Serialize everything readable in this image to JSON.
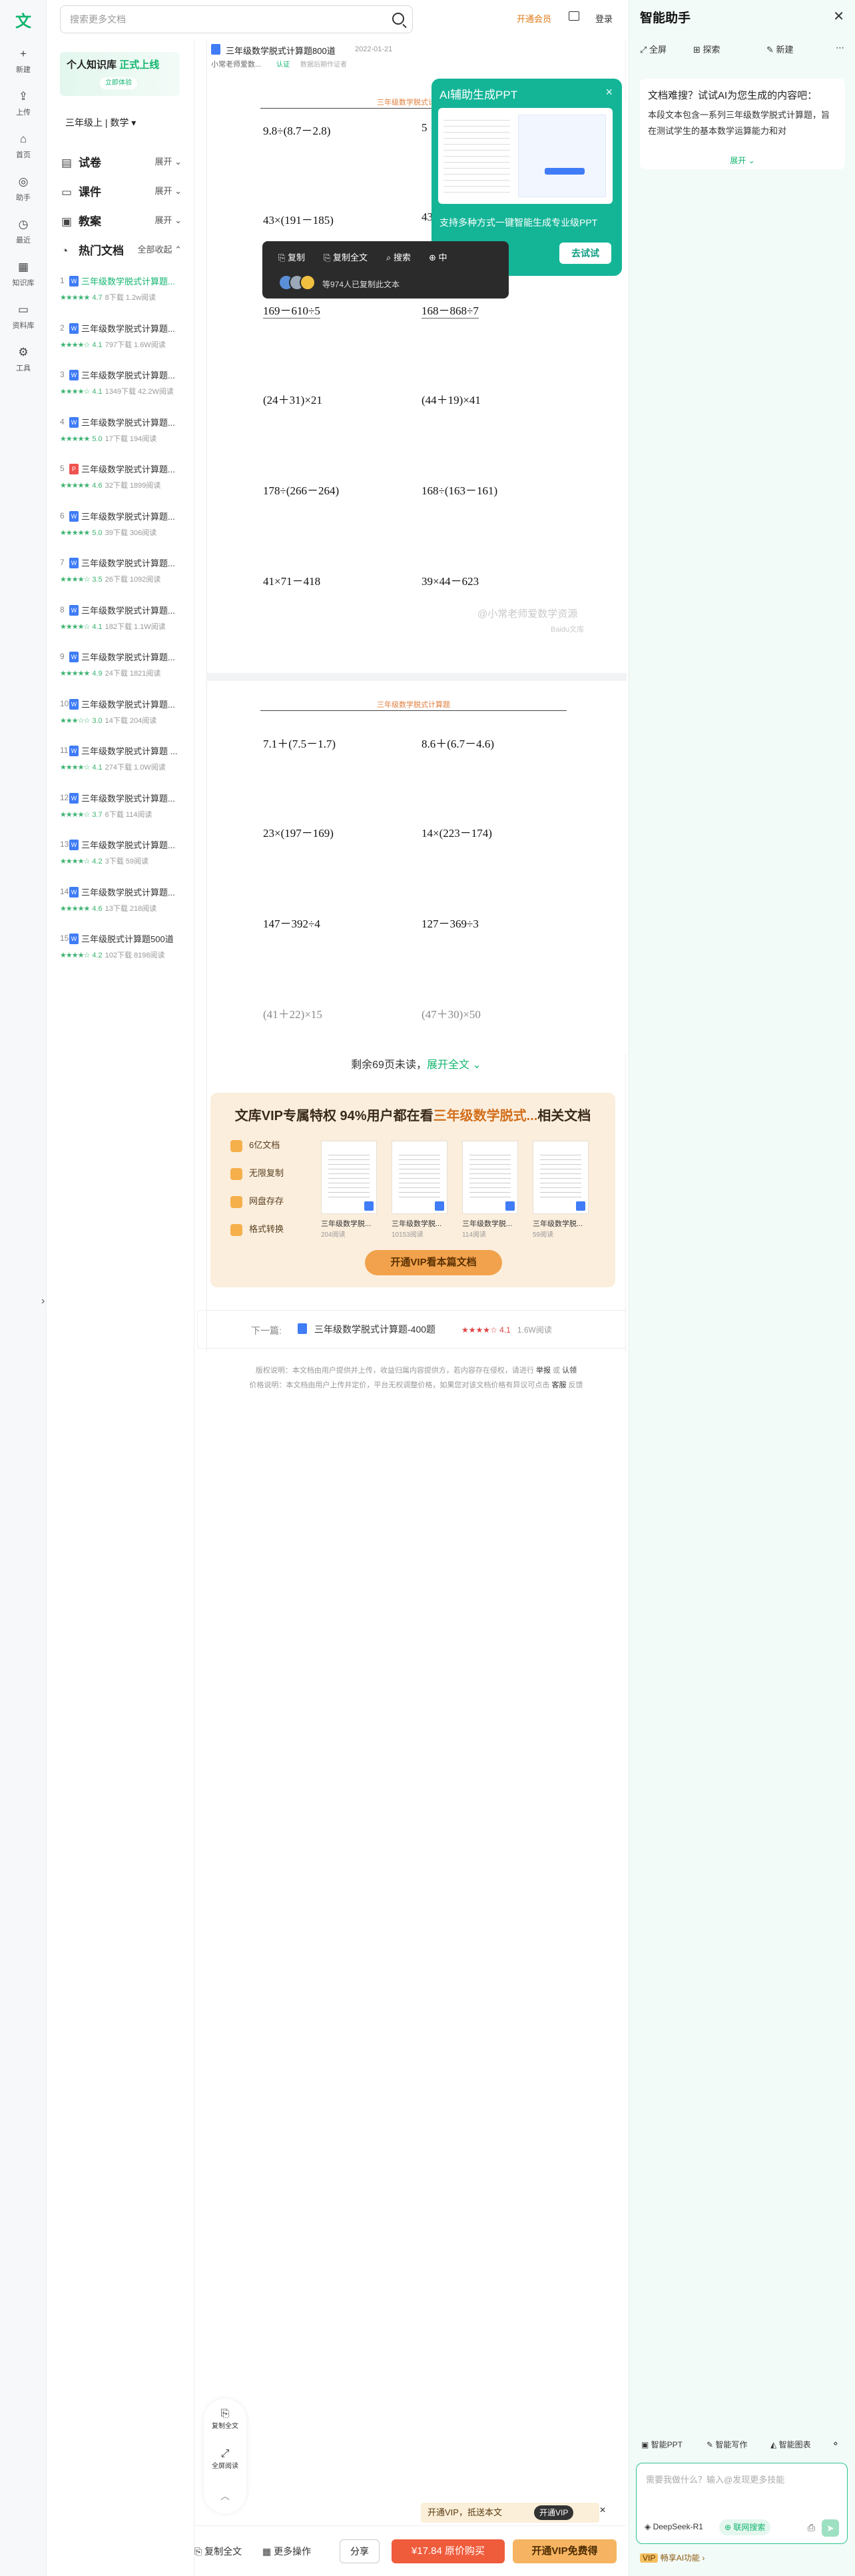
{
  "search": {
    "placeholder": "搜索更多文档"
  },
  "header": {
    "open_vip": "开通会员",
    "login": "登录"
  },
  "rail": {
    "logo": "文",
    "items": [
      {
        "label": "新建",
        "icon": "+"
      },
      {
        "label": "上传",
        "icon": "⇪"
      },
      {
        "label": "首页",
        "icon": "⌂"
      },
      {
        "label": "助手",
        "icon": "◎"
      },
      {
        "label": "最近",
        "icon": "◷"
      },
      {
        "label": "知识库",
        "icon": "▦"
      },
      {
        "label": "资料库",
        "icon": "▭"
      },
      {
        "label": "工具",
        "icon": "⚙"
      }
    ]
  },
  "sidebar": {
    "banner_title": "个人知识库",
    "banner_highlight": "正式上线",
    "banner_button": "立即体验",
    "grade": "三年级上",
    "subject": "数学",
    "sections": [
      {
        "label": "试卷",
        "action": "展开"
      },
      {
        "label": "课件",
        "action": "展开"
      },
      {
        "label": "教案",
        "action": "展开"
      }
    ],
    "hot": {
      "label": "热门文档",
      "action": "全部收起"
    },
    "hot_items": [
      {
        "num": "1",
        "title": "三年级数学脱式计算题...",
        "rating": "4.7",
        "meta": "8下载  1.2w阅读",
        "type": "W"
      },
      {
        "num": "2",
        "title": "三年级数学脱式计算题...",
        "rating": "4.1",
        "meta": "797下载  1.6W阅读",
        "type": "W"
      },
      {
        "num": "3",
        "title": "三年级数学脱式计算题...",
        "rating": "4.1",
        "meta": "1349下载  42.2W阅读",
        "type": "W"
      },
      {
        "num": "4",
        "title": "三年级数学脱式计算题...",
        "rating": "5.0",
        "meta": "17下载  194阅读",
        "type": "W"
      },
      {
        "num": "5",
        "title": "三年级数学脱式计算题...",
        "rating": "4.6",
        "meta": "32下载  1899阅读",
        "type": "P"
      },
      {
        "num": "6",
        "title": "三年级数学脱式计算题...",
        "rating": "5.0",
        "meta": "39下载  306阅读",
        "type": "W"
      },
      {
        "num": "7",
        "title": "三年级数学脱式计算题...",
        "rating": "3.5",
        "meta": "26下载  1092阅读",
        "type": "W"
      },
      {
        "num": "8",
        "title": "三年级数学脱式计算题...",
        "rating": "4.1",
        "meta": "182下载  1.1W阅读",
        "type": "W"
      },
      {
        "num": "9",
        "title": "三年级数学脱式计算题...",
        "rating": "4.9",
        "meta": "24下载  1821阅读",
        "type": "W"
      },
      {
        "num": "10",
        "title": "三年级数学脱式计算题...",
        "rating": "3.0",
        "meta": "14下载  204阅读",
        "type": "W"
      },
      {
        "num": "11",
        "title": "三年级数学脱式计算题 ...",
        "rating": "4.1",
        "meta": "274下载  1.0W阅读",
        "type": "W"
      },
      {
        "num": "12",
        "title": "三年级数学脱式计算题...",
        "rating": "3.7",
        "meta": "6下载  114阅读",
        "type": "W"
      },
      {
        "num": "13",
        "title": "三年级数学脱式计算题...",
        "rating": "4.2",
        "meta": "3下载  59阅读",
        "type": "W"
      },
      {
        "num": "14",
        "title": "三年级数学脱式计算题...",
        "rating": "4.6",
        "meta": "13下载  218阅读",
        "type": "W"
      },
      {
        "num": "15",
        "title": "三年级脱式计算题500道",
        "rating": "4.2",
        "meta": "102下载  8198阅读",
        "type": "W"
      }
    ]
  },
  "doc": {
    "title": "三年级数学脱式计算题800道",
    "date": "2022-01-21",
    "author": "小常老师爱数...",
    "author_badge": "认证",
    "author_note": "数据后期作证者",
    "header_strip": "三年级数学脱式计算题",
    "page1": [
      "9.8÷(8.7－2.8)",
      "5",
      "43×(191－185)",
      "43",
      "169－610÷5",
      "168－868÷7",
      "(24＋31)×21",
      "(44＋19)×41",
      "178÷(266－264)",
      "168÷(163－161)",
      "41×71－418",
      "39×44－623"
    ],
    "watermark1": "@小常老师爱数学资源",
    "watermark2": "Baidu文库",
    "page2": [
      "7.1＋(7.5－1.7)",
      "8.6＋(6.7－4.6)",
      "23×(197－169)",
      "14×(223－174)",
      "147－392÷4",
      "127－369÷3",
      "(41＋22)×15",
      "(47＋30)×50"
    ],
    "remaining": "剩余69页未读，",
    "expand": "展开全文"
  },
  "ppt_popup": {
    "title": "AI辅助生成PPT",
    "desc": "支持多种方式一键智能生成专业级PPT",
    "button": "去试试"
  },
  "toolbar": {
    "copy": "复制",
    "copy_all": "复制全文",
    "search": "搜索",
    "more": "中",
    "copied_note": "等974人已复制此文本"
  },
  "vip": {
    "title_pre": "文库VIP专属特权 94%用户都在看",
    "title_em": "三年级数学脱式...",
    "title_post": "相关文档",
    "perks": [
      "6亿文档",
      "无限复制",
      "网盘存存",
      "格式转换"
    ],
    "docs": [
      {
        "name": "三年级数学脱...",
        "count": "204阅读"
      },
      {
        "name": "三年级数学脱...",
        "count": "10153阅读"
      },
      {
        "name": "三年级数学脱...",
        "count": "114阅读"
      },
      {
        "name": "三年级数学脱...",
        "count": "59阅读"
      }
    ],
    "button": "开通VIP看本篇文档"
  },
  "next": {
    "label": "下一篇:",
    "title": "三年级数学脱式计算题-400题",
    "stars": "★★★★☆",
    "rating": "4.1",
    "reads": "1.6W阅读"
  },
  "legal": {
    "line1": "版权说明：本文档由用户提供并上传，收益归属内容提供方，若内容存在侵权，请进行",
    "report": "举报",
    "or": "或",
    "claim": "认领",
    "line2": "价格说明：本文档由用户上传并定价，平台无权调整价格，如果您对该文档价格有异议可点击",
    "service": "客服",
    "feedback": "反馈"
  },
  "float": {
    "copy_all": "复制全文",
    "fullscreen": "全屏阅读"
  },
  "bottom": {
    "copy_all": "复制全文",
    "more_ops": "更多操作",
    "share": "分享",
    "buy": "¥17.84 原价购买",
    "vip_free": "开通VIP免费得",
    "hint": "开通VIP，抵送本文",
    "hint_vip": "开通VIP"
  },
  "panel": {
    "title": "智能助手",
    "actions": [
      "全屏",
      "探索",
      "新建"
    ],
    "card_q": "文档难搜？试试AI为您生成的内容吧：",
    "card_p": "本段文本包含一系列三年级数学脱式计算题，旨在测试学生的基本数学运算能力和对",
    "card_more": "展开",
    "tools": [
      "智能PPT",
      "智能写作",
      "智能图表"
    ],
    "input_placeholder": "需要我做什么？输入@发现更多技能",
    "model": "DeepSeek-R1",
    "net": "联网搜索",
    "vip_note": "畅享AI功能"
  },
  "colors": {
    "brand": "#13b66f",
    "panel_bg": "#f3fbf8",
    "popup": "#14b597",
    "buy": "#ef5c3c",
    "vip": "#f6b462"
  }
}
